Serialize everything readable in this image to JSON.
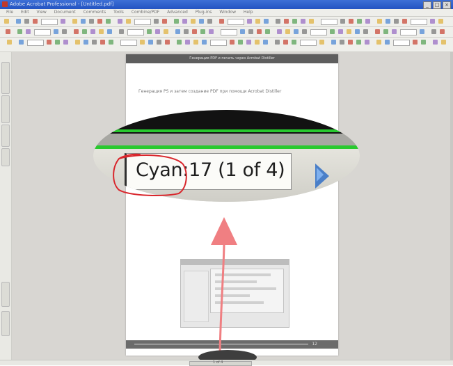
{
  "window": {
    "title": "Adobe Acrobat Professional - [Untitled.pdf]",
    "min_label": "_",
    "max_label": "□",
    "close_label": "×"
  },
  "menu": {
    "items": [
      "File",
      "Edit",
      "View",
      "Document",
      "Comments",
      "Tools",
      "Combine/PDF",
      "Advanced",
      "Plug-ins",
      "Window",
      "Help"
    ]
  },
  "page": {
    "header_text": "Генерация PDF и печать через Acrobat Distiller",
    "body_text": "Генерация PS и затем создание PDF при помощи Acrobat Distiller",
    "footer_page": "12"
  },
  "magnifier": {
    "separation_value": "Cyan:17 (1 of 4)"
  },
  "statusbar": {
    "page_indicator": "1 of 4"
  },
  "colors": {
    "accent_green": "#28c92e",
    "annotation_red": "#d9262c",
    "arrow_pink": "#f07f82",
    "nav_arrow_blue": "#4a7fc8"
  },
  "icons": {
    "next_page": "play-arrow-icon",
    "pointer": "up-arrow-icon"
  }
}
